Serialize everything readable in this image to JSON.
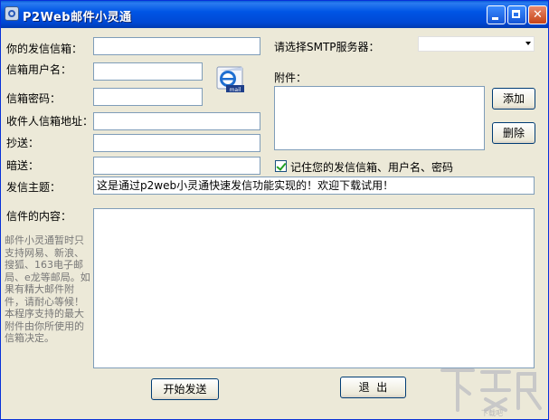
{
  "window": {
    "title": "P2Web邮件小灵通",
    "icon": "app-icon",
    "controls": {
      "minimize": "minimize-icon",
      "maximize": "maximize-icon",
      "close": "close-icon"
    }
  },
  "form": {
    "sender_email_label": "你的发信信箱：",
    "sender_email_value": "",
    "username_label": "信箱用户名：",
    "username_value": "",
    "password_label": "信箱密码：",
    "password_value": "",
    "recipient_label": "收件人信箱地址：",
    "recipient_value": "",
    "cc_label": "抄送：",
    "cc_value": "",
    "bcc_label": "暗送：",
    "bcc_value": "",
    "subject_label": "发信主题：",
    "subject_value": "这是通过p2web小灵通快速发信功能实现的！欢迎下载试用！",
    "content_label": "信件的内容：",
    "note": "邮件小灵通暂时只支持网易、新浪、搜狐、163电子邮局、e龙等邮局。如果有精大邮件附件，请耐心等候！本程序支持的最大附件由你所使用的信箱决定。"
  },
  "smtp": {
    "label": "请选择SMTP服务器：",
    "selected": ""
  },
  "attachments": {
    "label": "附件：",
    "add_label": "添加",
    "delete_label": "删除"
  },
  "remember": {
    "label": "记住您的发信信箱、用户名、密码",
    "checked": true
  },
  "buttons": {
    "send_label": "开始发送",
    "exit_label": "退  出"
  },
  "watermark": {
    "text": "下载吧"
  },
  "colors": {
    "titlebar": "#0055e5",
    "window_bg": "#ece9d8",
    "input_border": "#7f9db9",
    "close_button": "#c64316"
  }
}
